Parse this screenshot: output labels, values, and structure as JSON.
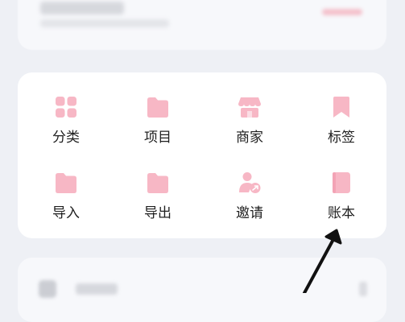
{
  "colors": {
    "page_background": "#eef0f5",
    "card_background": "#ffffff",
    "icon_pink": "#f7b7c5",
    "label_text": "#1f1f1f",
    "arrow": "#111111"
  },
  "menu": {
    "items": [
      {
        "label": "分类",
        "icon": "grid-icon"
      },
      {
        "label": "项目",
        "icon": "folder-icon"
      },
      {
        "label": "商家",
        "icon": "store-icon"
      },
      {
        "label": "标签",
        "icon": "bookmark-icon"
      },
      {
        "label": "导入",
        "icon": "folder-import-icon"
      },
      {
        "label": "导出",
        "icon": "folder-export-icon"
      },
      {
        "label": "邀请",
        "icon": "invite-user-icon"
      },
      {
        "label": "账本",
        "icon": "ledger-book-icon"
      }
    ]
  },
  "annotation": {
    "type": "arrow",
    "points_to": "账本"
  }
}
